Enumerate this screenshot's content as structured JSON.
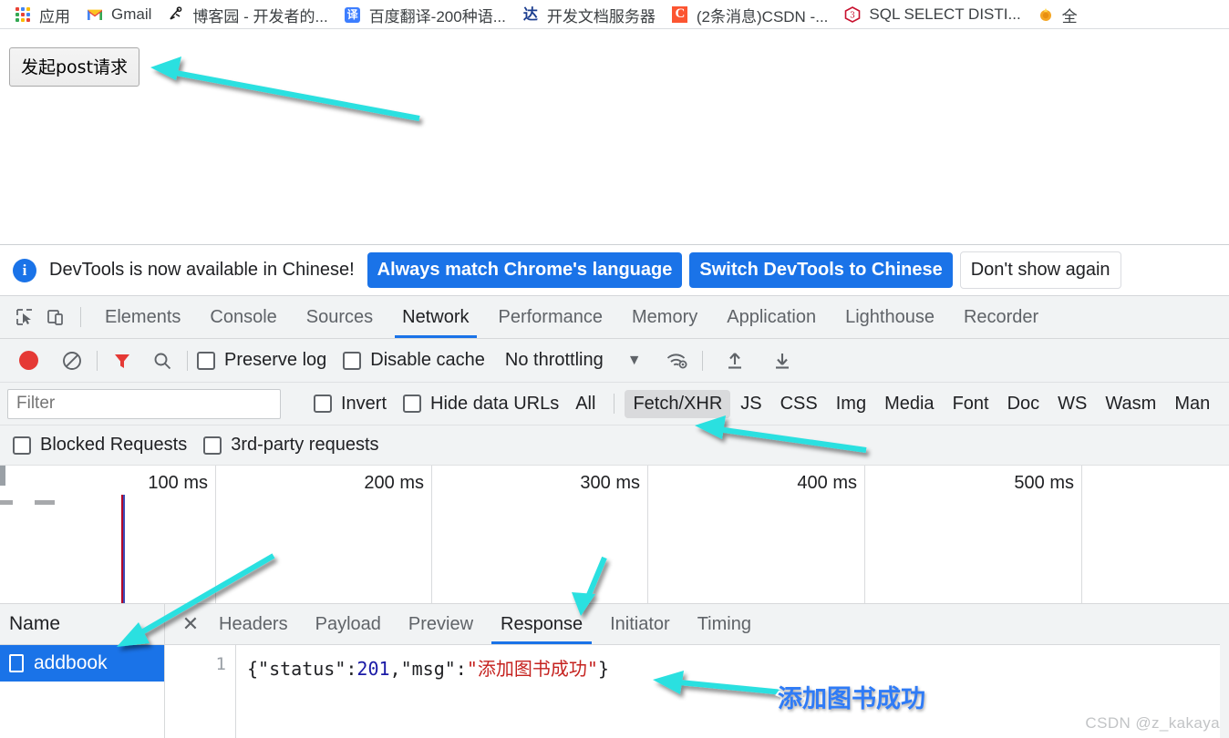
{
  "bookmarks": {
    "items": [
      {
        "label": "应用",
        "icon": "apps-grid-icon"
      },
      {
        "label": "Gmail",
        "icon": "gmail-icon"
      },
      {
        "label": "博客园 - 开发者的...",
        "icon": "cnblogs-icon"
      },
      {
        "label": "百度翻译-200种语...",
        "icon": "baidu-translate-icon"
      },
      {
        "label": "开发文档服务器",
        "icon": "dev-docs-icon"
      },
      {
        "label": "(2条消息)CSDN -...",
        "icon": "csdn-icon"
      },
      {
        "label": "SQL SELECT DISTI...",
        "icon": "w3school-icon"
      },
      {
        "label": "全",
        "icon": "bookmark-generic-icon"
      }
    ]
  },
  "page": {
    "post_button_label": "发起post请求"
  },
  "notice": {
    "icon": "info-icon",
    "message": "DevTools is now available in Chinese!",
    "primary_label": "Always match Chrome's language",
    "secondary_label": "Switch DevTools to Chinese",
    "dismiss_label": "Don't show again"
  },
  "devtools": {
    "inspect_icon": "inspect-element-icon",
    "device_icon": "device-toolbar-icon",
    "tabs": [
      {
        "label": "Elements",
        "active": false
      },
      {
        "label": "Console",
        "active": false
      },
      {
        "label": "Sources",
        "active": false
      },
      {
        "label": "Network",
        "active": true
      },
      {
        "label": "Performance",
        "active": false
      },
      {
        "label": "Memory",
        "active": false
      },
      {
        "label": "Application",
        "active": false
      },
      {
        "label": "Lighthouse",
        "active": false
      },
      {
        "label": "Recorder",
        "active": false
      }
    ]
  },
  "network_toolbar": {
    "record_icon": "record-button-icon",
    "clear_icon": "clear-network-icon",
    "filter_icon": "filter-funnel-icon",
    "search_icon": "search-icon",
    "preserve_log_label": "Preserve log",
    "preserve_log_checked": false,
    "disable_cache_label": "Disable cache",
    "disable_cache_checked": false,
    "throttling_value": "No throttling",
    "throttling_caret": "▼",
    "wifi_icon": "network-conditions-icon",
    "import_icon": "import-har-icon",
    "export_icon": "export-har-icon"
  },
  "filter_row": {
    "filter_placeholder": "Filter",
    "filter_value": "",
    "invert_label": "Invert",
    "invert_checked": false,
    "hide_data_urls_label": "Hide data URLs",
    "hide_data_urls_checked": false,
    "types": [
      {
        "label": "All",
        "selected": false
      },
      {
        "label": "Fetch/XHR",
        "selected": true
      },
      {
        "label": "JS",
        "selected": false
      },
      {
        "label": "CSS",
        "selected": false
      },
      {
        "label": "Img",
        "selected": false
      },
      {
        "label": "Media",
        "selected": false
      },
      {
        "label": "Font",
        "selected": false
      },
      {
        "label": "Doc",
        "selected": false
      },
      {
        "label": "WS",
        "selected": false
      },
      {
        "label": "Wasm",
        "selected": false
      },
      {
        "label": "Man",
        "selected": false
      }
    ]
  },
  "blocked_row": {
    "blocked_requests_label": "Blocked Requests",
    "blocked_requests_checked": false,
    "third_party_label": "3rd-party requests",
    "third_party_checked": false
  },
  "overview": {
    "ticks": [
      "100 ms",
      "200 ms",
      "300 ms",
      "400 ms",
      "500 ms"
    ]
  },
  "requests": {
    "name_header": "Name",
    "rows": [
      {
        "name": "addbook",
        "icon": "document-icon",
        "selected": true
      }
    ]
  },
  "detail": {
    "close_icon": "close-icon",
    "tabs": [
      {
        "label": "Headers",
        "active": false
      },
      {
        "label": "Payload",
        "active": false
      },
      {
        "label": "Preview",
        "active": false
      },
      {
        "label": "Response",
        "active": true
      },
      {
        "label": "Initiator",
        "active": false
      },
      {
        "label": "Timing",
        "active": false
      }
    ],
    "response": {
      "line_number": "1",
      "prefix": "{\"status\":",
      "status_value": "201",
      "middle": ",\"msg\":",
      "message": "\"添加图书成功\"",
      "suffix": "}"
    }
  },
  "annotations": {
    "text_label": "添加图书成功",
    "arrow_color": "#2ae0e0"
  },
  "watermark": {
    "text": "CSDN @z_kakaya"
  },
  "colors": {
    "accent_blue": "#1a73e8",
    "devtools_bg": "#f1f3f4",
    "record_red": "#e53935",
    "annotation_cyan": "#2ae0e0",
    "annotation_text_blue": "#2f7bf6"
  }
}
